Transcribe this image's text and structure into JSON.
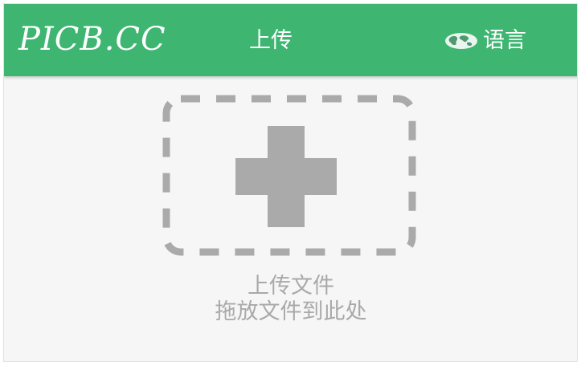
{
  "header": {
    "logo_text": "PICB.CC",
    "nav_upload_label": "上传",
    "language_label": "语言",
    "language_icon": "globe-icon"
  },
  "upload": {
    "icon": "plus-icon",
    "title": "上传文件",
    "hint": "拖放文件到此处"
  },
  "colors": {
    "header_bg": "#3eb672",
    "page_bg": "#f6f6f6",
    "dropzone_gray": "#aaaaaa",
    "text_gray": "#a9a9a9",
    "header_text": "#ffffff"
  }
}
